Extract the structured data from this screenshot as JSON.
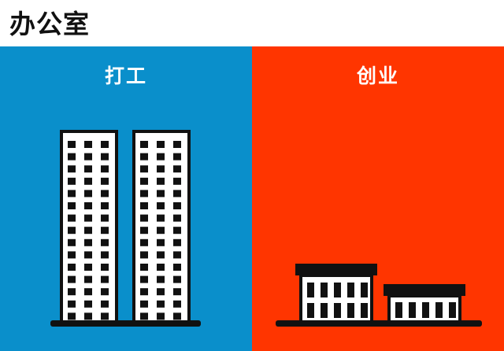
{
  "header": {
    "title": "办公室"
  },
  "panels": [
    {
      "label": "打工",
      "background": "#0A8FCB"
    },
    {
      "label": "创业",
      "background": "#FF3500"
    }
  ],
  "colors": {
    "outline": "#111111",
    "building_fill": "#ffffff",
    "window": "#111111"
  }
}
